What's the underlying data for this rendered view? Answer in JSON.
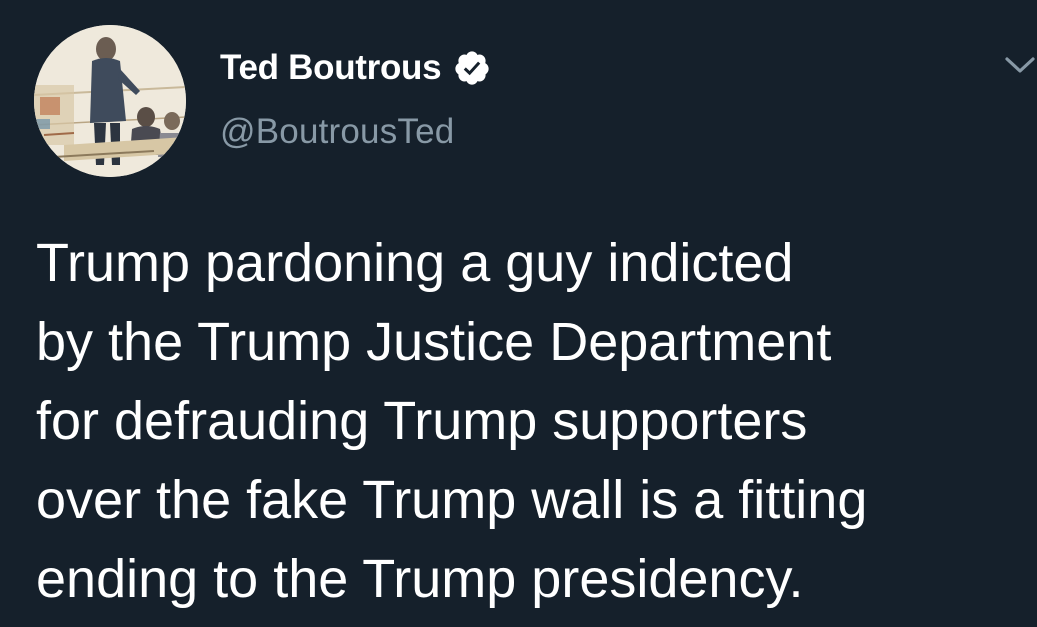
{
  "author": {
    "display_name": "Ted Boutrous",
    "handle": "@BoutrousTed",
    "verified": true,
    "avatar_icon": "courtroom-sketch-avatar",
    "verified_icon": "verified-badge-icon"
  },
  "menu": {
    "caret_icon": "chevron-down-icon"
  },
  "tweet": {
    "text": "Trump pardoning a guy indicted\nby the Trump Justice Department\nfor defrauding Trump supporters\nover the fake Trump wall is a fitting\nending to the Trump presidency."
  },
  "colors": {
    "background": "#15202b",
    "name": "#ffffff",
    "handle": "#8899a6",
    "verified_badge": "#ffffff"
  }
}
